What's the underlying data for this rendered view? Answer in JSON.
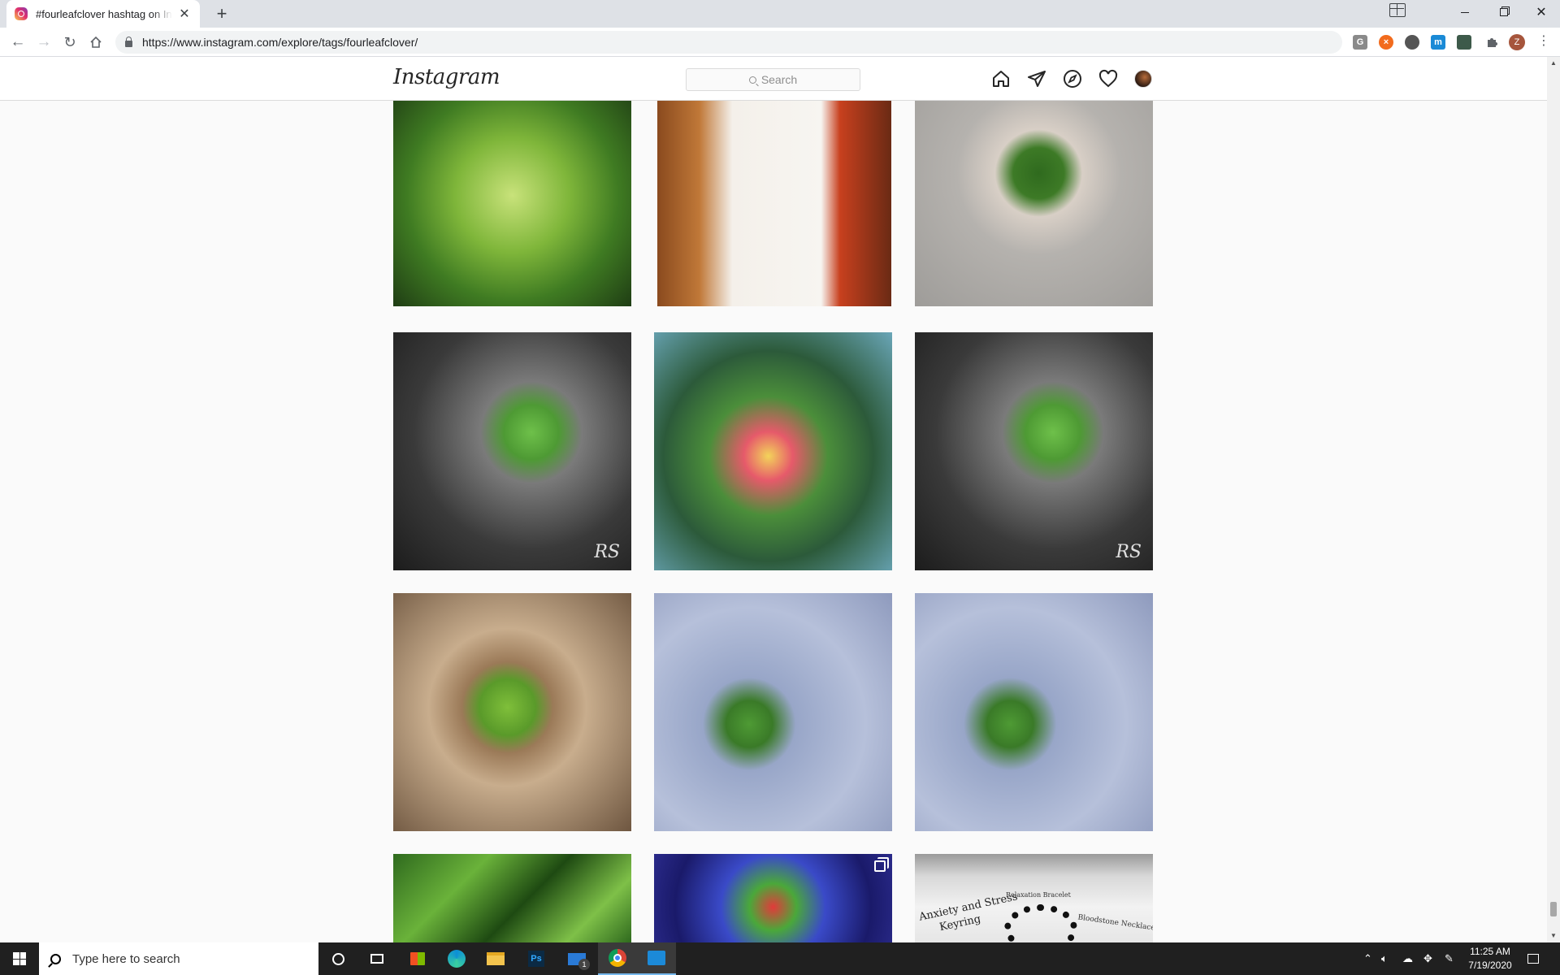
{
  "browser": {
    "tab_title": "#fourleafclover hashtag on Instagram",
    "tab_close": "✕",
    "new_tab": "+",
    "url": "https://www.instagram.com/explore/tags/fourleafclover/",
    "profile_initial": "Z",
    "extensions": [
      {
        "icon": "grammar-extension-icon",
        "label": "G",
        "color": "#8a8a8a"
      },
      {
        "icon": "orange-extension-icon",
        "label": "×",
        "color": "#f26b1d"
      },
      {
        "icon": "circle-extension-icon",
        "label": "",
        "color": "#555555"
      },
      {
        "icon": "m-extension-icon",
        "label": "m",
        "color": "#1a8ad6"
      },
      {
        "icon": "dark-extension-icon",
        "label": "",
        "color": "#3d5a4a"
      }
    ]
  },
  "instagram": {
    "logo": "Instagram",
    "search_placeholder": "Search",
    "nav_icons": [
      "home-icon",
      "direct-icon",
      "explore-icon",
      "activity-icon",
      "profile-avatar"
    ],
    "posts": [
      {
        "desc": "four-leaf clover close-up",
        "bg": "radial-gradient(circle at 50% 50%, #c8e27a 0%, #7fb63a 35%, #3f7b22 65%, #1f3d14 100%)"
      },
      {
        "desc": "person with sunglasses",
        "bg": "linear-gradient(90deg, #8a4a1e 0%, #c07838 18%, #f4f0ea 32%, #f7f5f1 70%, #c8401e 78%, #6a2a14 100%)"
      },
      {
        "desc": "hand holding clover",
        "bg": "radial-gradient(circle at 52% 40%, #2f6a1e 0%, #3d7a26 14%, #d8cfc6 24%, #b5b2ae 45%, #9e9c99 100%)"
      },
      {
        "desc": "clover black and white",
        "bg": "radial-gradient(circle at 58% 42%, #6ec04a 0%, #4e9a34 14%, #7a7a7a 26%, #3a3a3a 60%, #1c1c1c 100%)",
        "mark": "RS"
      },
      {
        "desc": "pink yellow flower",
        "bg": "radial-gradient(circle at 48% 52%, #f3d35a 0%, #e65a6a 14%, #4b8e3a 34%, #2c5a3a 60%, #6aa6b8 100%)"
      },
      {
        "desc": "clover black and white",
        "bg": "radial-gradient(circle at 58% 42%, #6ec04a 0%, #4e9a34 14%, #7a7a7a 26%, #3a3a3a 60%, #1c1c1c 100%)",
        "mark": "RS"
      },
      {
        "desc": "clover on wood",
        "bg": "radial-gradient(circle at 48% 48%, #7fbf3a 0%, #5a9a2a 16%, #9b7a58 26%, #c8ad8d 45%, #6e5640 100%)"
      },
      {
        "desc": "clovers on denim",
        "bg": "radial-gradient(circle at 40% 55%, #4e9a34 0%, #3a7a28 12%, #98a6c8 24%, #b6c0da 60%, #8e9abd 100%)"
      },
      {
        "desc": "clovers on denim",
        "bg": "radial-gradient(circle at 40% 55%, #4e9a34 0%, #3a7a28 12%, #98a6c8 24%, #b6c0da 60%, #8e9abd 100%)"
      },
      {
        "desc": "grass",
        "bg": "linear-gradient(135deg, #2f6a1e 0%, #6ab23a 30%, #1e4a12 55%, #7ec048 80%, #2f6a1e 100%)"
      },
      {
        "desc": "painted clover",
        "bg": "radial-gradient(circle at 50% 60%, #e23a3a 0%, #4aa83a 18%, #3a4ac8 40%, #1a1a6a 75%, #2a2a8a 100%)",
        "multi": true
      },
      {
        "desc": "anxiety bracelet",
        "bg": "linear-gradient(180deg, #9a9a9a 0%, #d8d8d8 25%, #f2f2f2 60%, #e6e6e6 100%)"
      }
    ],
    "bracelet_texts": [
      "Anxiety and Stress",
      "Keyring",
      "Relaxation Bracelet",
      "Bloodstone Necklace"
    ]
  },
  "taskbar": {
    "search_text": "Type here to search",
    "mail_badge": "1",
    "time": "11:25 AM",
    "date": "7/19/2020"
  }
}
